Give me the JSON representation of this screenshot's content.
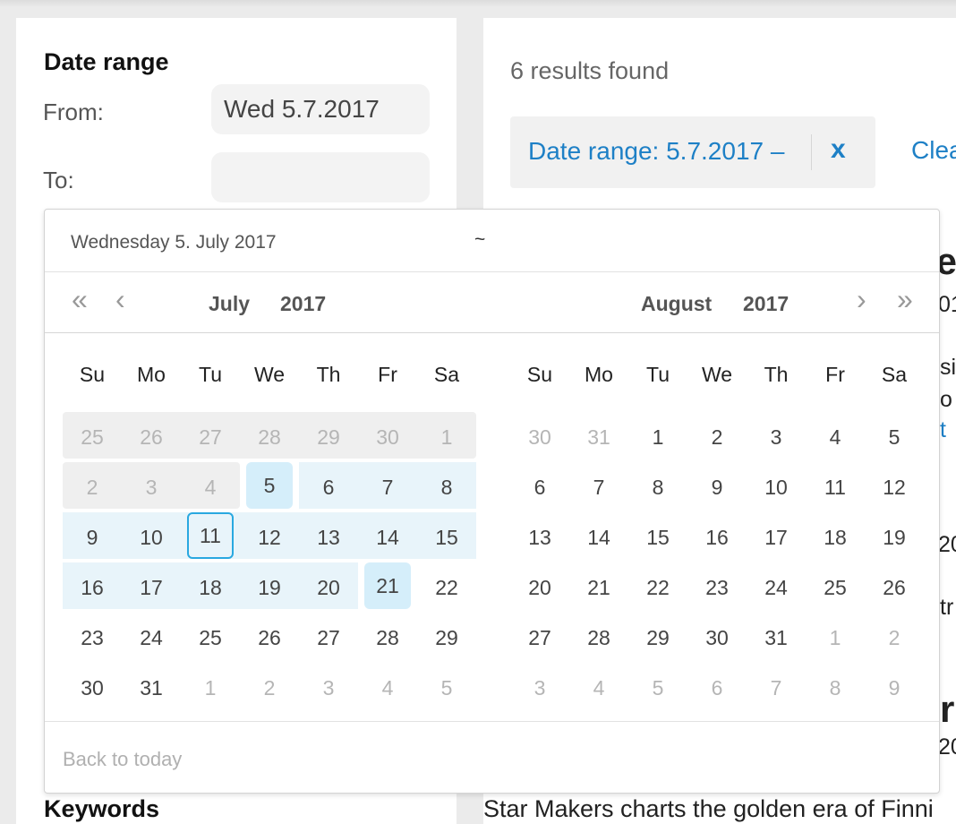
{
  "filters": {
    "date_range_title": "Date range",
    "from_label": "From:",
    "from_value": "Wed 5.7.2017",
    "to_label": "To:",
    "to_value": "",
    "keywords_title": "Keywords"
  },
  "results": {
    "count_text": "6 results found",
    "chip_label": "Date range: 5.7.2017 –",
    "chip_remove": "x",
    "clear_label": "Clea",
    "fragments": [
      "ie",
      "01",
      "si",
      "o",
      "t",
      "20",
      "tr",
      "r",
      "20"
    ],
    "bottom_text": "Star Makers charts the golden era of Finni"
  },
  "picker": {
    "selected_text": "Wednesday 5. July 2017",
    "range_separator": "~",
    "nav": {
      "prev_year": "«",
      "prev_month": "‹",
      "next_month": "›",
      "next_year": "»"
    },
    "weekdays": [
      "Su",
      "Mo",
      "Tu",
      "We",
      "Th",
      "Fr",
      "Sa"
    ],
    "months": [
      {
        "month": "July",
        "year": "2017",
        "days": [
          "25",
          "26",
          "27",
          "28",
          "29",
          "30",
          "1",
          "2",
          "3",
          "4",
          "5",
          "6",
          "7",
          "8",
          "9",
          "10",
          "11",
          "12",
          "13",
          "14",
          "15",
          "16",
          "17",
          "18",
          "19",
          "20",
          "21",
          "22",
          "23",
          "24",
          "25",
          "26",
          "27",
          "28",
          "29",
          "30",
          "31",
          "1",
          "2",
          "3",
          "4",
          "5"
        ],
        "kind": [
          "d",
          "d",
          "d",
          "d",
          "d",
          "d",
          "d",
          "d",
          "d",
          "d",
          "start",
          "r",
          "r",
          "r",
          "r",
          "r",
          "today",
          "r",
          "r",
          "r",
          "r",
          "r",
          "r",
          "r",
          "r",
          "r",
          "hover",
          "n",
          "n",
          "n",
          "n",
          "n",
          "n",
          "n",
          "n",
          "n",
          "n",
          "o",
          "o",
          "o",
          "o",
          "o"
        ]
      },
      {
        "month": "August",
        "year": "2017",
        "days": [
          "30",
          "31",
          "1",
          "2",
          "3",
          "4",
          "5",
          "6",
          "7",
          "8",
          "9",
          "10",
          "11",
          "12",
          "13",
          "14",
          "15",
          "16",
          "17",
          "18",
          "19",
          "20",
          "21",
          "22",
          "23",
          "24",
          "25",
          "26",
          "27",
          "28",
          "29",
          "30",
          "31",
          "1",
          "2",
          "3",
          "4",
          "5",
          "6",
          "7",
          "8",
          "9"
        ],
        "kind": [
          "o",
          "o",
          "n",
          "n",
          "n",
          "n",
          "n",
          "n",
          "n",
          "n",
          "n",
          "n",
          "n",
          "n",
          "n",
          "n",
          "n",
          "n",
          "n",
          "n",
          "n",
          "n",
          "n",
          "n",
          "n",
          "n",
          "n",
          "n",
          "n",
          "n",
          "n",
          "n",
          "n",
          "o",
          "o",
          "o",
          "o",
          "o",
          "o",
          "o",
          "o",
          "o"
        ]
      }
    ],
    "footer_link": "Back to today",
    "colors": {
      "accent": "#1e80c6",
      "range_bg": "#e8f4fa",
      "selected_bg": "#d5eefa",
      "today_border": "#29a8e0",
      "disabled_bg": "#efefef",
      "muted_text": "#b5b5b5"
    }
  }
}
